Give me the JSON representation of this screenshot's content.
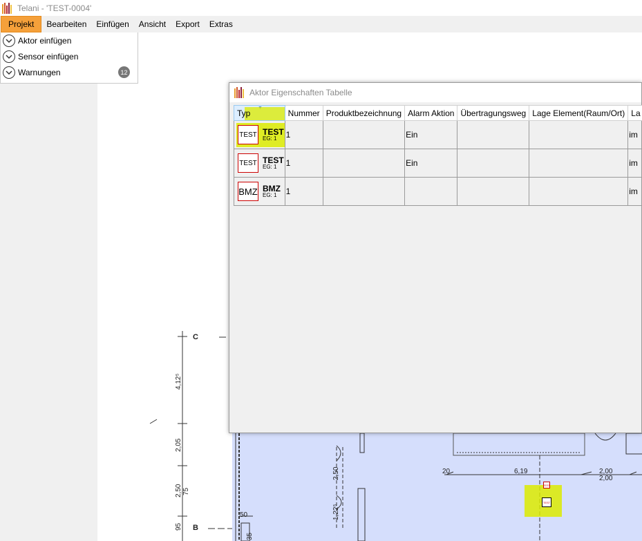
{
  "window": {
    "title": "Telani - 'TEST-0004'"
  },
  "menu": [
    {
      "label": "Projekt",
      "active": true
    },
    {
      "label": "Bearbeiten"
    },
    {
      "label": "Einfügen"
    },
    {
      "label": "Ansicht"
    },
    {
      "label": "Export"
    },
    {
      "label": "Extras"
    }
  ],
  "dropdown": {
    "items": [
      {
        "label": "Aktor einfügen",
        "icon": "chevron-down-circle-icon"
      },
      {
        "label": "Sensor einfügen",
        "icon": "chevron-down-circle-icon"
      },
      {
        "label": "Warnungen",
        "icon": "chevron-down-circle-icon",
        "badge": "12"
      }
    ]
  },
  "dialog": {
    "title": "Aktor Eigenschaften Tabelle",
    "columns": [
      "Typ",
      "Nummer",
      "Produktbezeichnung",
      "Alarm Aktion",
      "Übertragungsweg",
      "Lage Element(Raum/Ort)",
      "La"
    ],
    "rows": [
      {
        "typ_icon": "TEST",
        "typ_name": "TEST",
        "typ_sub": "EG: 1",
        "nummer": "1",
        "produkt": "",
        "alarm": "Ein",
        "uebertragung": "",
        "lage": "",
        "la": "im"
      },
      {
        "typ_icon": "TEST",
        "typ_name": "TEST",
        "typ_sub": "EG: 1",
        "nummer": "1",
        "produkt": "",
        "alarm": "Ein",
        "uebertragung": "",
        "lage": "",
        "la": "im"
      },
      {
        "typ_icon": "BMZ",
        "typ_name": "BMZ",
        "typ_sub": "EG: 1",
        "nummer": "1",
        "produkt": "",
        "alarm": "",
        "uebertragung": "",
        "lage": "",
        "la": "im"
      }
    ]
  },
  "plan": {
    "axis_c": "C",
    "axis_b": "B",
    "dim_412": "4,12⁵",
    "dim_205": "2,05",
    "dim_250": "2,50",
    "dim_75": "75",
    "dim_95": "95",
    "dim_250b": "2,50",
    "dim_122": "1,22⁵",
    "dim_20": "20",
    "dim_619": "6,19",
    "dim_200a": "2,00",
    "dim_200b": "2,00",
    "dim_50": "50",
    "dim_35": "35",
    "marker_label": "TEST"
  },
  "colors": {
    "menu_active": "#f5a03a",
    "highlight": "#dceb00",
    "room_fill": "#d5defc",
    "marker_red": "#cc0000"
  }
}
